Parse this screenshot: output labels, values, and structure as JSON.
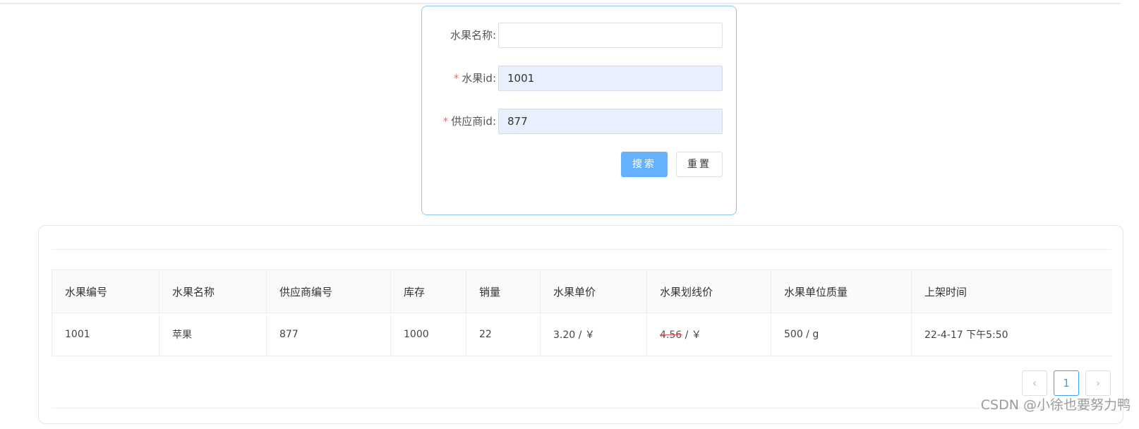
{
  "search_form": {
    "fields": [
      {
        "label": "水果名称:",
        "required": false,
        "value": ""
      },
      {
        "label": "水果id:",
        "required": true,
        "value": "1001"
      },
      {
        "label": "供应商id:",
        "required": true,
        "value": "877"
      }
    ],
    "search_label": "搜索",
    "reset_label": "重置",
    "required_mark": "*"
  },
  "table": {
    "columns": [
      "水果编号",
      "水果名称",
      "供应商编号",
      "库存",
      "销量",
      "水果单价",
      "水果划线价",
      "水果单位质量",
      "上架时间"
    ],
    "rows": [
      {
        "fruit_id": "1001",
        "fruit_name": "苹果",
        "supplier_id": "877",
        "stock": "1000",
        "sales": "22",
        "unit_price": "3.20 / ￥",
        "list_price_value": "4.56",
        "list_price_suffix": " / ￥",
        "unit_weight": "500 / g",
        "listed_time": "22-4-17 下午5:50"
      }
    ]
  },
  "pagination": {
    "prev_icon": "‹",
    "current_page": "1",
    "next_icon": "›"
  },
  "watermark": "CSDN @小徐也要努力鸭",
  "colors": {
    "primary": "#66b1ff",
    "active_page": "#409eff",
    "required": "#f56c6c",
    "form_border": "#8fc8ee"
  }
}
